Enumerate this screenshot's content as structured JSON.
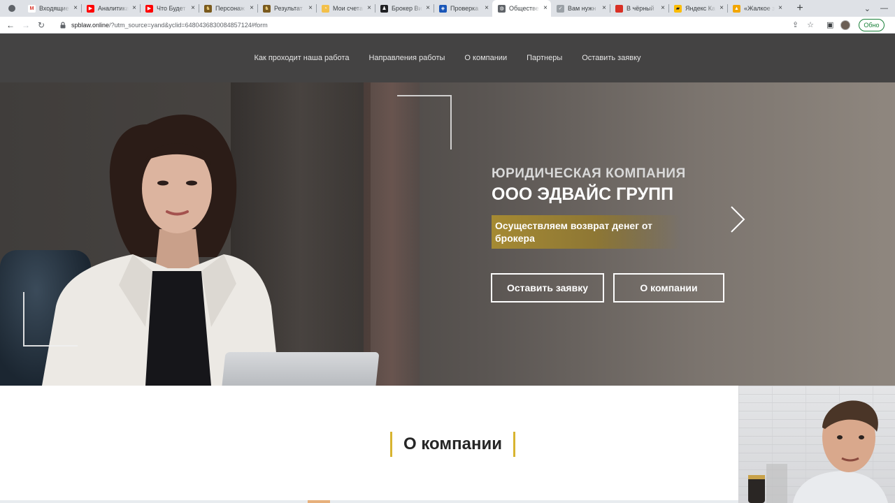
{
  "browser": {
    "tabs": [
      {
        "title": "Входящие",
        "fav_color": "#ffffff",
        "fav_glyph": "M",
        "fav_text": "#d93025"
      },
      {
        "title": "Аналитика",
        "fav_color": "#ff0000",
        "fav_glyph": "▶",
        "fav_text": "#ffffff"
      },
      {
        "title": "Что Будет",
        "fav_color": "#ff0000",
        "fav_glyph": "▶",
        "fav_text": "#ffffff"
      },
      {
        "title": "Персонаж",
        "fav_color": "#7a5a1e",
        "fav_glyph": "♞",
        "fav_text": "#f1d27a"
      },
      {
        "title": "Результат",
        "fav_color": "#7a5a1e",
        "fav_glyph": "♞",
        "fav_text": "#f1d27a"
      },
      {
        "title": "Мои счета",
        "fav_color": "#f3c04a",
        "fav_glyph": "◔",
        "fav_text": "#ffffff"
      },
      {
        "title": "Брокер Ви",
        "fav_color": "#202124",
        "fav_glyph": "♟",
        "fav_text": "#ffffff"
      },
      {
        "title": "Проверка",
        "fav_color": "#1a56b8",
        "fav_glyph": "◈",
        "fav_text": "#ffffff"
      },
      {
        "title": "Обществе",
        "fav_color": "#5f6368",
        "fav_glyph": "◍",
        "fav_text": "#ffffff",
        "active": true
      },
      {
        "title": "Вам нужн",
        "fav_color": "#9aa0a6",
        "fav_glyph": "✓",
        "fav_text": "#ffffff"
      },
      {
        "title": "В чёрный",
        "fav_color": "#d93025",
        "fav_glyph": "",
        "fav_text": "#ffffff"
      },
      {
        "title": "Яндекс Ка",
        "fav_color": "#fbbc04",
        "fav_glyph": "▰",
        "fav_text": "#202124"
      },
      {
        "title": "«Жалкое з",
        "fav_color": "#f2a600",
        "fav_glyph": "▲",
        "fav_text": "#ffffff"
      }
    ],
    "url_host": "spblaw.online",
    "url_path": "/?utm_source=yand&yclid=6480436830084857124#form",
    "update_label": "Обно"
  },
  "nav": {
    "items": [
      "Как проходит наша работа",
      "Направления работы",
      "О компании",
      "Партнеры",
      "Оставить заявку"
    ]
  },
  "hero": {
    "kicker": "ЮРИДИЧЕСКАЯ КОМПАНИЯ",
    "title": "ООО ЭДВАЙС ГРУПП",
    "tagline": "Осуществляем возврат денег от брокера",
    "primary_button": "Оставить заявку",
    "secondary_button": "О компании",
    "accent_color": "#a58a33"
  },
  "about": {
    "title": "О компании",
    "accent_color": "#d8b430"
  }
}
